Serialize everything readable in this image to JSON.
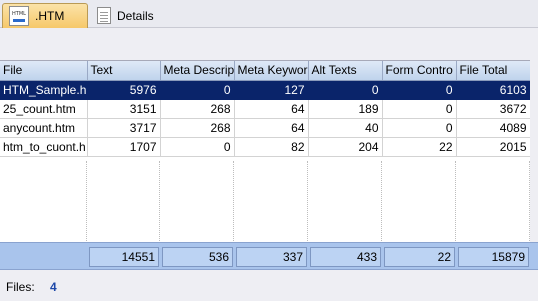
{
  "tabs": [
    {
      "label": ".HTM",
      "icon": "html-file-icon",
      "icon_text": "HTML",
      "active": true
    },
    {
      "label": "Details",
      "icon": "document-icon",
      "active": false
    }
  ],
  "table": {
    "columns": [
      "File",
      "Text",
      "Meta Descrip",
      "Meta Keywor",
      "Alt Texts",
      "Form Contro",
      "File Total"
    ],
    "rows": [
      [
        "HTM_Sample.h",
        "5976",
        "0",
        "127",
        "0",
        "0",
        "6103"
      ],
      [
        "25_count.htm",
        "3151",
        "268",
        "64",
        "189",
        "0",
        "3672"
      ],
      [
        "anycount.htm",
        "3717",
        "268",
        "64",
        "40",
        "0",
        "4089"
      ],
      [
        "htm_to_cuont.h",
        "1707",
        "0",
        "82",
        "204",
        "22",
        "2015"
      ]
    ],
    "selected_row": 0,
    "totals": [
      "14551",
      "536",
      "337",
      "433",
      "22",
      "15879"
    ]
  },
  "status": {
    "files_label": "Files:",
    "files_value": "4"
  },
  "colors": {
    "selection": "#0a246a",
    "totals_bar": "#a9c4ec",
    "active_tab": "#f6c86a"
  }
}
